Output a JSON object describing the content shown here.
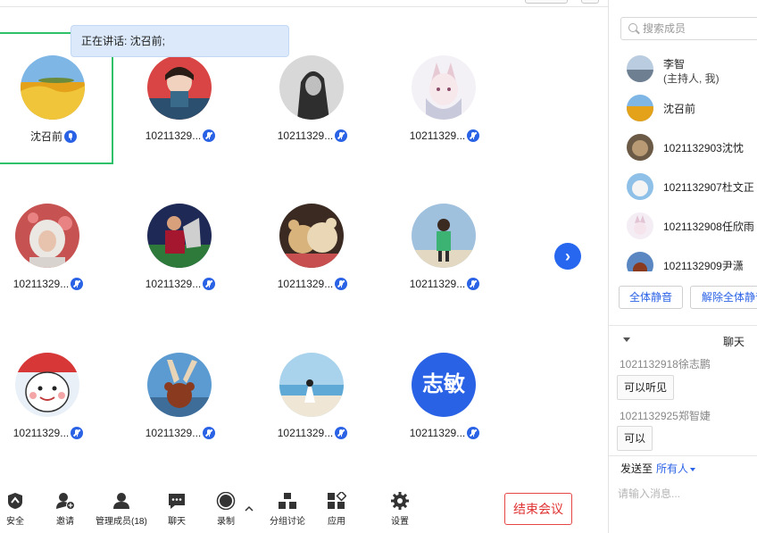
{
  "speaking_banner": "正在讲话: 沈召前;",
  "grid": {
    "tiles": [
      {
        "name": "沈召前",
        "mic": "on",
        "avatar": "golden-field",
        "bg": "#e3a21a"
      },
      {
        "name": "10211329...",
        "mic": "muted",
        "avatar": "person-red",
        "bg": "#a8262a"
      },
      {
        "name": "10211329...",
        "mic": "muted",
        "avatar": "person-bw",
        "bg": "#555555"
      },
      {
        "name": "10211329...",
        "mic": "muted",
        "avatar": "anime-fox",
        "bg": "#e6e8f2"
      },
      {
        "name": "10211329...",
        "mic": "muted",
        "avatar": "person-snow",
        "bg": "#b54a4a"
      },
      {
        "name": "10211329...",
        "mic": "muted",
        "avatar": "soccer-player",
        "bg": "#23306b"
      },
      {
        "name": "10211329...",
        "mic": "muted",
        "avatar": "teddy-bears",
        "bg": "#b88255"
      },
      {
        "name": "10211329...",
        "mic": "muted",
        "avatar": "person-green",
        "bg": "#7aa5c8"
      },
      {
        "name": "10211329...",
        "mic": "muted",
        "avatar": "cartoon-face",
        "bg": "#d63535"
      },
      {
        "name": "10211329...",
        "mic": "muted",
        "avatar": "teddy-sky",
        "bg": "#5b9bd1"
      },
      {
        "name": "10211329...",
        "mic": "muted",
        "avatar": "beach",
        "bg": "#8fc3e0"
      },
      {
        "name": "10211329...",
        "mic": "muted",
        "avatar": "text-avatar",
        "bg": "#2a62e6",
        "text": "志敏"
      }
    ]
  },
  "toolbar": {
    "security": "安全",
    "invite": "邀请",
    "manage_members": "管理成员(18)",
    "chat": "聊天",
    "record": "录制",
    "breakout": "分组讨论",
    "apps": "应用",
    "settings": "设置",
    "end_meeting": "结束会议"
  },
  "panel": {
    "search_placeholder": "搜索成员",
    "members": [
      {
        "name": "李智",
        "sub": "(主持人, 我)",
        "bg": "#9cb4cf"
      },
      {
        "name": "沈召前",
        "sub": "",
        "bg": "#e3a21a"
      },
      {
        "name": "1021132903沈忱",
        "sub": "",
        "bg": "#8d7454"
      },
      {
        "name": "1021132907杜文正",
        "sub": "",
        "bg": "#8fc0e8"
      },
      {
        "name": "1021132908任欣雨",
        "sub": "",
        "bg": "#e9dbe8"
      },
      {
        "name": "1021132909尹潇",
        "sub": "",
        "bg": "#5a87c2"
      }
    ],
    "mute_all": "全体静音",
    "unmute_all": "解除全体静音",
    "chat_title": "聊天",
    "chat_messages": [
      {
        "sender": "1021132918徐志鹏",
        "text": "可以听见"
      },
      {
        "sender": "1021132925郑智婕",
        "text": "可以"
      }
    ],
    "send_to_label": "发送至",
    "send_to_target": "所有人",
    "input_placeholder": "请输入消息..."
  },
  "colors": {
    "accent": "#2a62e6",
    "speaking_border": "#2fc06a",
    "end_meeting": "#e03131"
  }
}
